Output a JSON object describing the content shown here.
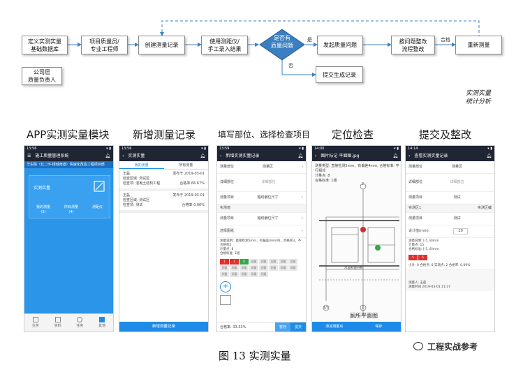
{
  "flowchart": {
    "nodes": {
      "define": "定义实测实量\n基础数据库",
      "role": "项目质量员/\n专业工程师",
      "create": "创建测量记录",
      "input": "使用测距仪/\n手工录入结果",
      "decision": "是否有\n质量问题",
      "issue": "发起质量问题",
      "rectify": "按问题整改\n流程整改",
      "remeasure": "重新测量",
      "submit": "提交生成记录",
      "company": "公司层\n质量负责人",
      "stats": "实测实量\n统计分析"
    },
    "edge_labels": {
      "yes": "是",
      "no": "否",
      "pass": "合格"
    }
  },
  "sections": [
    "APP实测实量模块",
    "新增测量记录",
    "填写部位、选择检查项目",
    "定位检查",
    "提交及整改"
  ],
  "phone1": {
    "status": "13:56",
    "title": "施工质量管理系统",
    "subtitle": "华东院（北二环-绿城南道）快速化改造工程项目部",
    "card_label": "实测实量",
    "cols": [
      {
        "label": "我的测量",
        "count": "(3)"
      },
      {
        "label": "所有测量",
        "count": "(4)"
      },
      {
        "label": "测距仪",
        "count": ""
      }
    ],
    "nav": [
      "业务",
      "资料",
      "任务",
      "其他"
    ]
  },
  "phone2": {
    "status": "13:56",
    "title": "实测实量",
    "tabs": [
      "我的测量",
      "所有测量"
    ],
    "records": [
      {
        "user": "王磊",
        "date": "发布于 2019-03-01",
        "area_label": "检查区域:",
        "area": "测试区",
        "item_label": "检查项:",
        "item": "混凝土结构工程",
        "rate": "合格率 66.67%"
      },
      {
        "user": "王磊",
        "date": "发布于 2019-03-01",
        "area_label": "检查区域:",
        "area": "测试区",
        "item_label": "检查项:",
        "item": "测试",
        "rate": "合格率 0.00%"
      }
    ],
    "button": "新增测量记录"
  },
  "phone3": {
    "status": "13:59",
    "title": "新增实测实量记录",
    "rows": [
      {
        "label": "测量部位",
        "value": "测量区"
      },
      {
        "label": "详细部位",
        "value": "详细部位"
      },
      {
        "label": "测量项目",
        "value": "轴线偏位尺寸"
      },
      {
        "label": "实测值",
        "value": ""
      },
      {
        "label": "测量项目",
        "value": "轴线偏位尺寸"
      },
      {
        "label": "选择图纸",
        "value": ""
      }
    ],
    "note": "测量说明：直接检测5mm，有偏差4mm内，合格率3，不合格率2",
    "count": "计量点: 8",
    "pass": "合格标准: 1组",
    "cells": [
      "1",
      "1",
      "0",
      "测量",
      "测量",
      "测量",
      "测量",
      "测量",
      "测量",
      "测量",
      "测量",
      "测量",
      "测量",
      "测量",
      "测量",
      "测量",
      "测量",
      "测量",
      "测量",
      "测量",
      "测量"
    ],
    "rate_label": "合格率:",
    "rate": "33.33%",
    "save": "暂存",
    "submit": "提交"
  },
  "phone4": {
    "status": "14:00",
    "title": "图片标记 平面图.jpg",
    "info": [
      "测量类型: 直接检测5mm，有偏差4mm, 合格标准: 平行相邻",
      "计量点: 8",
      "合格标准: 1组"
    ],
    "axis_top": "2",
    "axis_bottom_left": "1/1",
    "axis_bottom_right": "2",
    "label_pool": "水面积量分析",
    "plan_caption": "厕所平面图",
    "btn_left": "添加测量点",
    "btn_right": "保存"
  },
  "phone5": {
    "status": "14:14",
    "title": "查看实测实量记录",
    "rows": [
      {
        "label": "测量部位",
        "value": "测量区"
      },
      {
        "label": "详细部位",
        "value": "详细部位"
      },
      {
        "label": "测量项目",
        "value": "测试"
      }
    ],
    "section": "实测区1",
    "section_right": "实测区编",
    "design_label": "设计值(mm):",
    "design_value": "20",
    "range": "测量说明: [-5, 8]mm",
    "count": "计量点: 15",
    "std": "合格标准: [-5, 8]mm",
    "results": [
      "5",
      "5"
    ],
    "summary": "小计: 0  合格点: 0   实测点: 2   合格率: 0.00%",
    "footer1": "测量人: 王磊",
    "footer2": "测量时间 2019-03-01 11:37"
  },
  "caption": "图 13 实测实量",
  "watermark": "工程实战参考"
}
